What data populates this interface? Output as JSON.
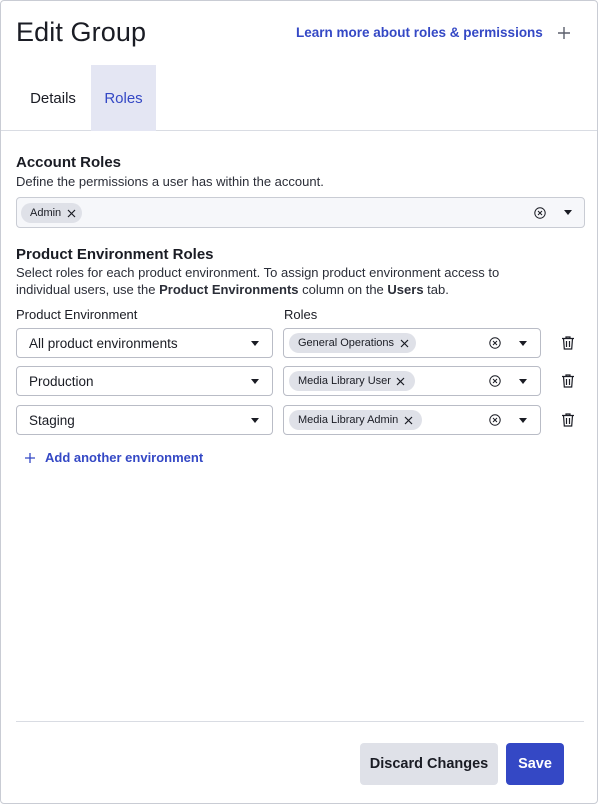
{
  "header": {
    "title": "Edit Group",
    "learn_link": "Learn more about roles & permissions"
  },
  "tabs": [
    {
      "label": "Details",
      "active": false
    },
    {
      "label": "Roles",
      "active": true
    }
  ],
  "account_roles": {
    "title": "Account Roles",
    "description": "Define the permissions a user has within the account.",
    "selected": [
      {
        "label": "Admin"
      }
    ]
  },
  "product_env_roles": {
    "title": "Product Environment Roles",
    "description_part1": "Select roles for each product environment. To assign product environment access to individual users, use the ",
    "description_bold1": "Product Environments",
    "description_part2": " column on the ",
    "description_bold2": "Users",
    "description_part3": " tab.",
    "col_env": "Product Environment",
    "col_roles": "Roles",
    "rows": [
      {
        "environment": "All product environments",
        "role": "General Operations"
      },
      {
        "environment": "Production",
        "role": "Media Library User"
      },
      {
        "environment": "Staging",
        "role": "Media Library Admin"
      }
    ],
    "add_label": "Add another environment"
  },
  "footer": {
    "discard_label": "Discard Changes",
    "save_label": "Save"
  },
  "colors": {
    "accent": "#3448c5",
    "active_tab_bg": "#e4e6f3",
    "chip_bg": "#dfe1e8"
  },
  "icons": [
    "plus-icon",
    "close-icon",
    "clear-circle-icon",
    "caret-down-icon",
    "trash-icon"
  ]
}
